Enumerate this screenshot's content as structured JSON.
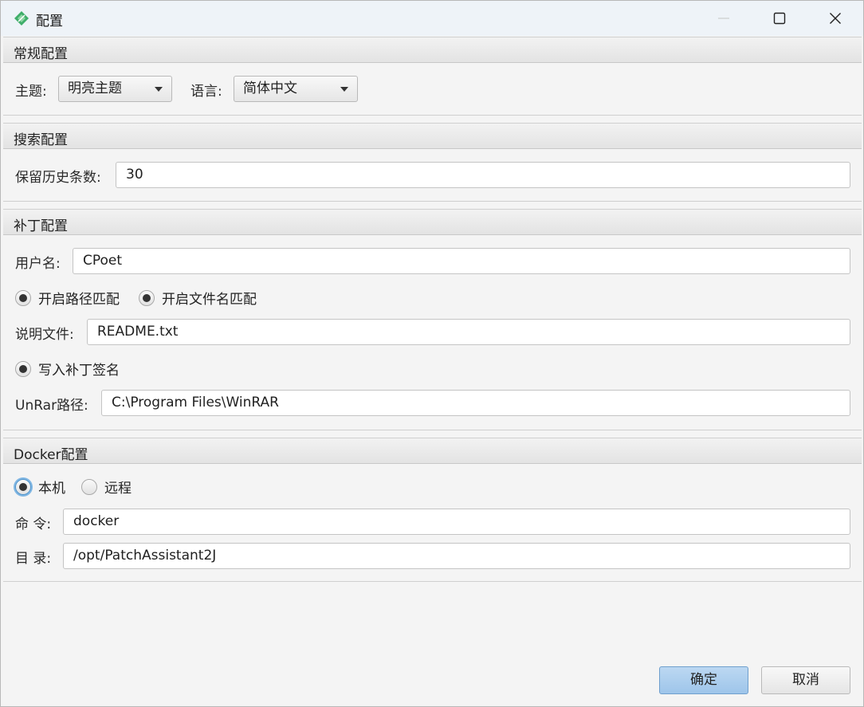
{
  "window": {
    "title": "配置",
    "buttons": {
      "minimize": "minimize-icon",
      "maximize": "maximize-icon",
      "close": "close-icon"
    }
  },
  "general": {
    "header": "常规配置",
    "theme_label": "主题:",
    "theme_value": "明亮主题",
    "language_label": "语言:",
    "language_value": "简体中文"
  },
  "search": {
    "header": "搜索配置",
    "history_label": "保留历史条数:",
    "history_value": "30"
  },
  "patch": {
    "header": "补丁配置",
    "username_label": "用户名:",
    "username_value": "CPoet",
    "path_match_label": "开启路径匹配",
    "path_match_selected": true,
    "filename_match_label": "开启文件名匹配",
    "filename_match_selected": true,
    "readme_label": "说明文件:",
    "readme_value": "README.txt",
    "signature_label": "写入补丁签名",
    "signature_selected": true,
    "unrar_label": "UnRar路径:",
    "unrar_value": "C:\\Program Files\\WinRAR"
  },
  "docker": {
    "header": "Docker配置",
    "local_label": "本机",
    "local_selected": true,
    "remote_label": "远程",
    "remote_selected": false,
    "command_label": "命 令:",
    "command_value": "docker",
    "dir_label": "目 录:",
    "dir_value": "/opt/PatchAssistant2J"
  },
  "footer": {
    "ok_label": "确定",
    "cancel_label": "取消"
  },
  "colors": {
    "accent": "#9ec5ea",
    "focus_ring": "#7fb6e3"
  }
}
